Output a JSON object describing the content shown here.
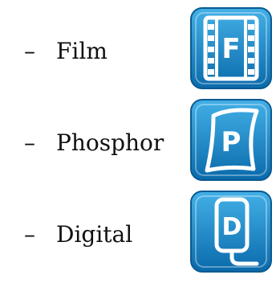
{
  "items": [
    {
      "dash": "–",
      "label": "Film",
      "icon_name": "film-icon",
      "icon_letter": "F"
    },
    {
      "dash": "–",
      "label": "Phosphor",
      "icon_name": "phosphor-plate-icon",
      "icon_letter": "P"
    },
    {
      "dash": "–",
      "label": "Digital",
      "icon_name": "digital-sensor-icon",
      "icon_letter": "D"
    }
  ],
  "colors": {
    "tile_top": "#3aa6dc",
    "tile_bottom": "#0b6fb0",
    "tile_border": "#0a5a92",
    "icon_white": "#ffffff",
    "text": "#111111"
  }
}
